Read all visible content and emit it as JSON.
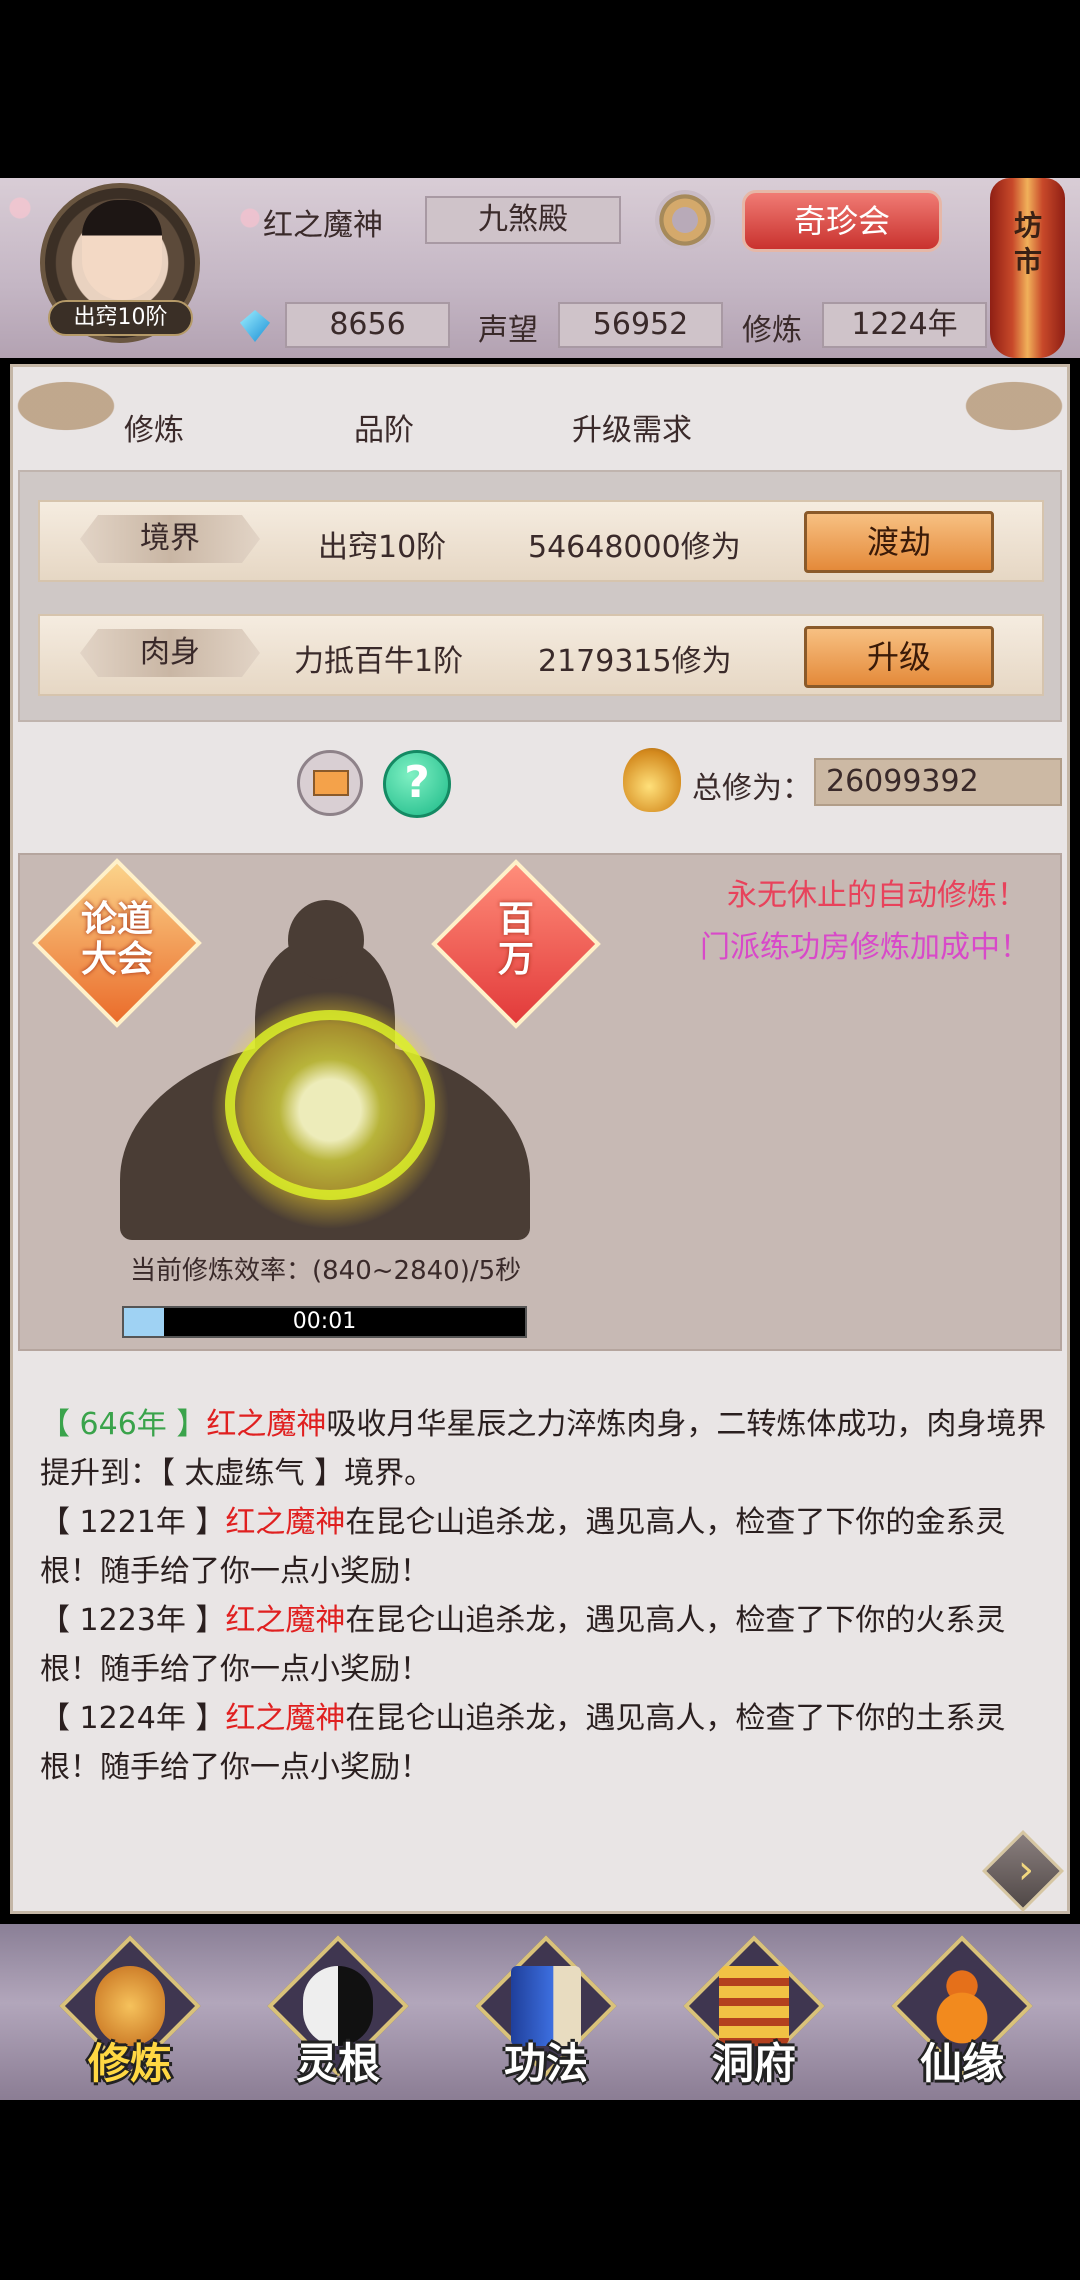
{
  "header": {
    "avatar_rank": "出窍10阶",
    "player_name": "红之魔神",
    "sect": "九煞殿",
    "treasure_button": "奇珍会",
    "market_label": "坊市",
    "gems": "8656",
    "reputation_label": "声望",
    "reputation": "56952",
    "cultivation_label": "修炼",
    "cultivation_years": "1224年"
  },
  "panel": {
    "columns": [
      "修炼",
      "品阶",
      "升级需求"
    ],
    "rows": [
      {
        "tag": "境界",
        "level": "出窍10阶",
        "requirement": "54648000修为",
        "button": "渡劫"
      },
      {
        "tag": "肉身",
        "level": "力抵百牛1阶",
        "requirement": "2179315修为",
        "button": "升级"
      }
    ],
    "help_symbol": "?",
    "total_label": "总修为：",
    "total_value": "26099392"
  },
  "scene": {
    "badge_left": "论道\n大会",
    "badge_right": "百\n万",
    "promo_1": "永无休止的自动修炼！",
    "promo_2": "门派练功房修炼加成中！",
    "rate_text": "当前修炼效率：(840~2840)/5秒",
    "timer": "00:01",
    "timer_progress": 0.1
  },
  "log": [
    {
      "year": "【 646年 】",
      "name": "红之魔神",
      "text": "吸收月华星辰之力淬炼肉身，二转炼体成功，肉身境界提升到：【 太虚练气 】境界。"
    },
    {
      "year": "【 1221年 】",
      "name": "红之魔神",
      "text": "在昆仑山追杀龙，遇见高人，检查了下你的金系灵根！随手给了你一点小奖励！"
    },
    {
      "year": "【 1223年 】",
      "name": "红之魔神",
      "text": "在昆仑山追杀龙，遇见高人，检查了下你的火系灵根！随手给了你一点小奖励！"
    },
    {
      "year": "【 1224年 】",
      "name": "红之魔神",
      "text": "在昆仑山追杀龙，遇见高人，检查了下你的土系灵根！随手给了你一点小奖励！"
    }
  ],
  "nav": {
    "items": [
      {
        "label": "修炼",
        "icon": "cultivator-icon",
        "active": true
      },
      {
        "label": "灵根",
        "icon": "yin-yang-sword-icon",
        "active": false
      },
      {
        "label": "功法",
        "icon": "book-icon",
        "active": false
      },
      {
        "label": "洞府",
        "icon": "pagoda-icon",
        "active": false
      },
      {
        "label": "仙缘",
        "icon": "gourd-icon",
        "active": false
      }
    ]
  },
  "colors": {
    "accent_red": "#e02020",
    "year_green": "#3aa34b",
    "promo_pink": "#e8425b",
    "promo_magenta": "#d849c9",
    "button_orange": "#e48a3a"
  }
}
